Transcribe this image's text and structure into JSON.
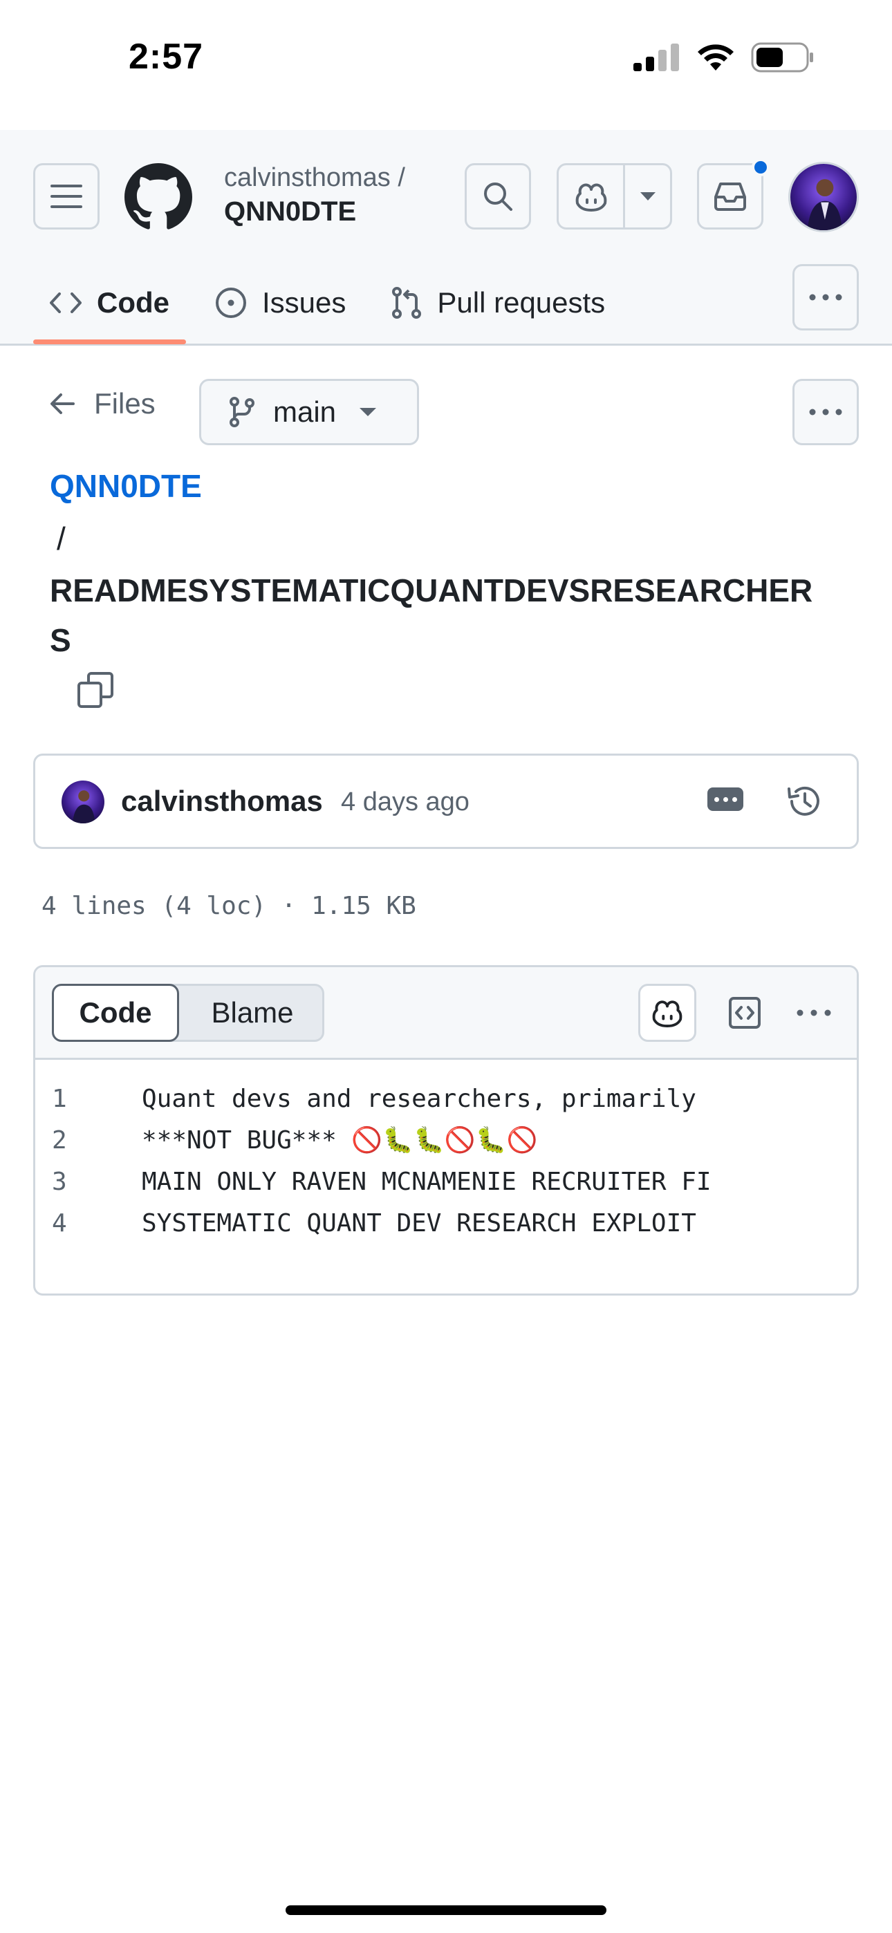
{
  "status_bar": {
    "time": "2:57"
  },
  "header": {
    "repo_owner": "calvinsthomas /",
    "repo_name": "QNN0DTE",
    "tabs": [
      {
        "label": "Code",
        "active": true
      },
      {
        "label": "Issues",
        "active": false
      },
      {
        "label": "Pull requests",
        "active": false
      }
    ]
  },
  "file_nav": {
    "back_label": "Files",
    "branch": "main"
  },
  "breadcrumb": {
    "repo": "QNN0DTE",
    "separator": "/",
    "file_name": "READMESYSTEMATICQUANTDEVSRESEARCHERS"
  },
  "commit": {
    "author": "calvinsthomas",
    "time": "4 days ago"
  },
  "file_meta": "4 lines (4 loc) · 1.15 KB",
  "viewer": {
    "code_tab": "Code",
    "blame_tab": "Blame",
    "lines": [
      {
        "no": "1",
        "text": "Quant devs and researchers, primarily"
      },
      {
        "no": "2",
        "text": "***NOT BUG*** 🚫🐛🐛🚫🐛🚫"
      },
      {
        "no": "3",
        "text": "MAIN ONLY RAVEN MCNAMENIE RECRUITER FI"
      },
      {
        "no": "4",
        "text": "SYSTEMATIC QUANT DEV RESEARCH EXPLOIT"
      }
    ]
  },
  "colors": {
    "link": "#0969da",
    "tab_underline": "#fd8c73",
    "notification_dot": "#0969da"
  },
  "icons": [
    "signal-icon",
    "wifi-icon",
    "battery-icon",
    "hamburger-icon",
    "github-logo",
    "search-icon",
    "copilot-icon",
    "chevron-down-icon",
    "inbox-icon",
    "code-icon",
    "issue-icon",
    "pull-request-icon",
    "kebab-icon",
    "arrow-left-icon",
    "branch-icon",
    "copy-icon",
    "history-icon",
    "raw-icon"
  ]
}
